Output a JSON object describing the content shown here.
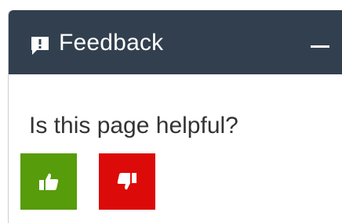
{
  "feedback": {
    "header_title": "Feedback",
    "header_icon": "speech-bubble-exclamation-icon",
    "collapse_icon": "minus-icon",
    "question": "Is this page helpful?",
    "yes_icon": "thumbs-up-icon",
    "no_icon": "thumbs-down-icon"
  },
  "colors": {
    "header_background": "#323f4f",
    "yes_button": "#569c0b",
    "no_button": "#dd0a0a",
    "question_text": "#333333"
  }
}
